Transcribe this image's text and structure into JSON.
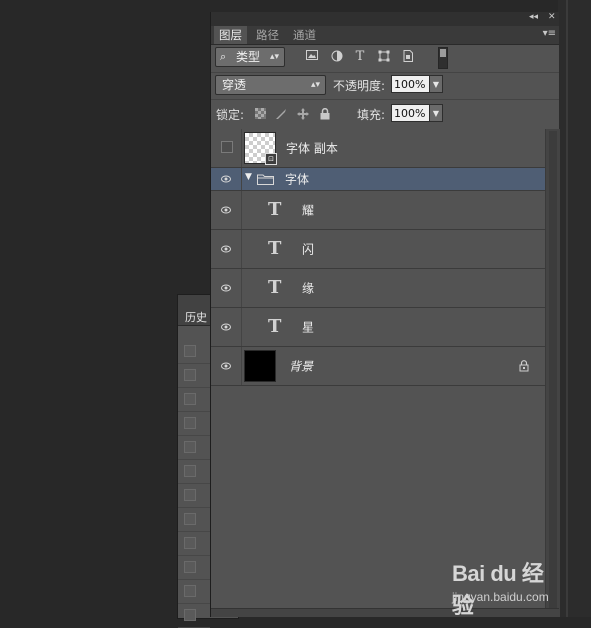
{
  "history_panel": {
    "tab_label": "历史",
    "row_count": 12
  },
  "panel_controls": {
    "collapse": "◂◂",
    "close": "✕",
    "menu": "▾≡"
  },
  "tabs": [
    {
      "label": "图层",
      "active": true
    },
    {
      "label": "路径",
      "active": false
    },
    {
      "label": "通道",
      "active": false
    }
  ],
  "filter": {
    "search_glyph": "⌕",
    "kind_label": "类型",
    "icons": [
      "image-filter-icon",
      "adjustment-filter-icon",
      "type-filter-icon",
      "shape-filter-icon",
      "smart-object-filter-icon"
    ]
  },
  "blend": {
    "mode": "穿透",
    "opacity_label": "不透明度:",
    "opacity_value": "100%"
  },
  "lock": {
    "label": "锁定:",
    "fill_label": "填充:",
    "fill_value": "100%"
  },
  "layers": [
    {
      "name": "字体 副本",
      "type": "smart-object",
      "visible": false
    },
    {
      "name": "字体",
      "type": "group",
      "visible": true,
      "expanded": true
    },
    {
      "name": "耀",
      "type": "text",
      "visible": true
    },
    {
      "name": "闪",
      "type": "text",
      "visible": true
    },
    {
      "name": "缘",
      "type": "text",
      "visible": true
    },
    {
      "name": "星",
      "type": "text",
      "visible": true
    },
    {
      "name": "背景",
      "type": "background",
      "visible": true,
      "locked": true
    }
  ],
  "watermark": {
    "brand": "Bai du 经验",
    "url": "jingyan.baidu.com"
  },
  "colors": {
    "workspace": "#282828",
    "panel": "#535353",
    "selected_layer": "#4f5e74"
  }
}
